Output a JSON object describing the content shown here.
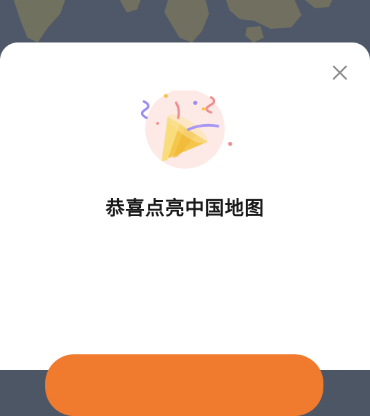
{
  "dialog": {
    "title": "恭喜点亮中国地图",
    "close_icon": "close-icon",
    "illustration_icon": "party-popper-icon",
    "cta_label": ""
  },
  "colors": {
    "accent": "#f07a2e",
    "backdrop": "#4f5868",
    "sheet": "#ffffff"
  }
}
